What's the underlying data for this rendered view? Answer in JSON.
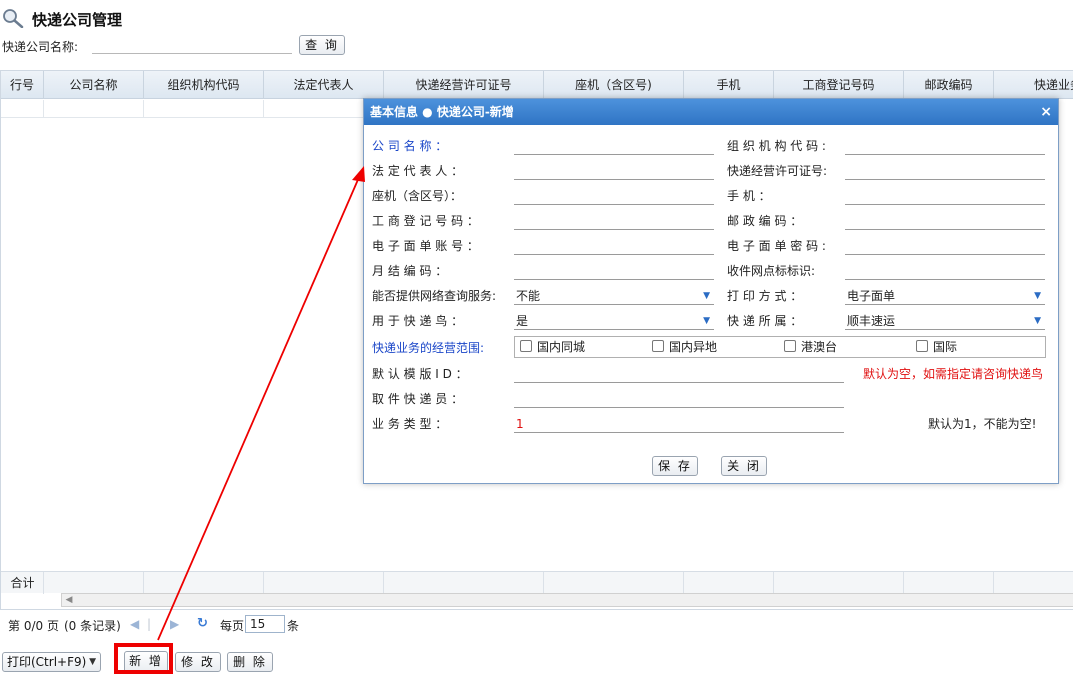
{
  "page": {
    "title": "快递公司管理"
  },
  "search": {
    "label": "快递公司名称:",
    "value": "",
    "button_label": "查 询"
  },
  "grid": {
    "columns": [
      "行号",
      "公司名称",
      "组织机构代码",
      "法定代表人",
      "快递经营许可证号",
      "座机（含区号)",
      "手机",
      "工商登记号码",
      "邮政编码",
      "快递业务"
    ],
    "footer_label": "合计"
  },
  "pager": {
    "page_info": "第 0/0 页",
    "record_info": "(0 条记录)",
    "per_page_label": "每页",
    "page_size": "15",
    "unit": "条"
  },
  "toolbar": {
    "print_label": "打印(Ctrl+F9)",
    "add_label": "新 增",
    "edit_label": "修 改",
    "delete_label": "删 除"
  },
  "dialog": {
    "title": "基本信息 ● 快递公司-新增",
    "close_glyph": "×",
    "left_labels": {
      "company_name": "公 司 名 称 ：",
      "legal_rep": "法 定 代 表 人 ：",
      "landline": "座机（含区号）：",
      "business_reg": "工 商 登 记 号 码 ：",
      "e_waybill_account": "电 子 面 单 账 号 ：",
      "monthly_code": "月 结 编 码 ：",
      "network_query": "能否提供网络查询服务:",
      "use_kdn": "用 于 快 递 鸟 ：",
      "business_scope": "快递业务的经营范围:",
      "default_template": "默 认 模 版 I D ：",
      "pickup_courier": "取 件 快 递 员 ：",
      "business_type": "业 务 类 型 ："
    },
    "right_labels": {
      "org_code": "组 织 机 构 代 码 :",
      "license_no": "快递经营许可证号:",
      "mobile": "手 机 ：",
      "postal_code": "邮 政 编 码 ：",
      "e_waybill_password": "电 子 面 单 密 码 :",
      "receiving_mark": "收件网点标标识:",
      "print_mode": "打 印 方 式 ：",
      "belongs_to": "快 递 所 属 ："
    },
    "values": {
      "network_query": "不能",
      "use_kdn": "是",
      "print_mode": "电子面单",
      "belongs_to": "顺丰速运",
      "business_type": "1"
    },
    "scope_options": [
      "国内同城",
      "国内异地",
      "港澳台",
      "国际"
    ],
    "hints": {
      "template": "默认为空，如需指定请咨询快递鸟",
      "business_type": "默认为1，不能为空!"
    },
    "save_label": "保 存",
    "close_label": "关 闭"
  },
  "colors": {
    "dialog_header": "#2f74c4",
    "highlight": "#ee0000",
    "required_label": "#1a46c8"
  }
}
